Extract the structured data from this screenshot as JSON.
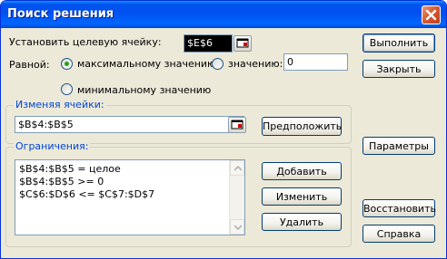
{
  "window": {
    "title": "Поиск решения"
  },
  "target": {
    "label": "Установить целевую ячейку:",
    "value": "$E$6"
  },
  "equal_to": {
    "label": "Равной:",
    "options": [
      {
        "label": "максимальному значению",
        "selected": true
      },
      {
        "label": "значению:",
        "selected": false
      },
      {
        "label": "минимальному значению",
        "selected": false
      }
    ],
    "value_field": "0"
  },
  "changing_cells": {
    "group_label": "Изменяя ячейки:",
    "value": "$B$4:$B$5",
    "guess_button": "Предположить"
  },
  "constraints": {
    "group_label": "Ограничения:",
    "items": [
      "$B$4:$B$5 = целое",
      "$B$4:$B$5 >= 0",
      "$C$6:$D$6 <= $C$7:$D$7"
    ],
    "add_button": "Добавить",
    "change_button": "Изменить",
    "delete_button": "Удалить"
  },
  "side_buttons": {
    "solve": "Выполнить",
    "close": "Закрыть",
    "options": "Параметры",
    "reset": "Восстановить",
    "help": "Справка"
  },
  "colors": {
    "titlebar": "#0053ee",
    "dialog_bg": "#ece9d8",
    "group_title": "#0046d5",
    "selection": "#000000"
  },
  "icons": [
    "close-icon",
    "collapse-dialog-icon",
    "scroll-up-icon",
    "scroll-down-icon"
  ]
}
